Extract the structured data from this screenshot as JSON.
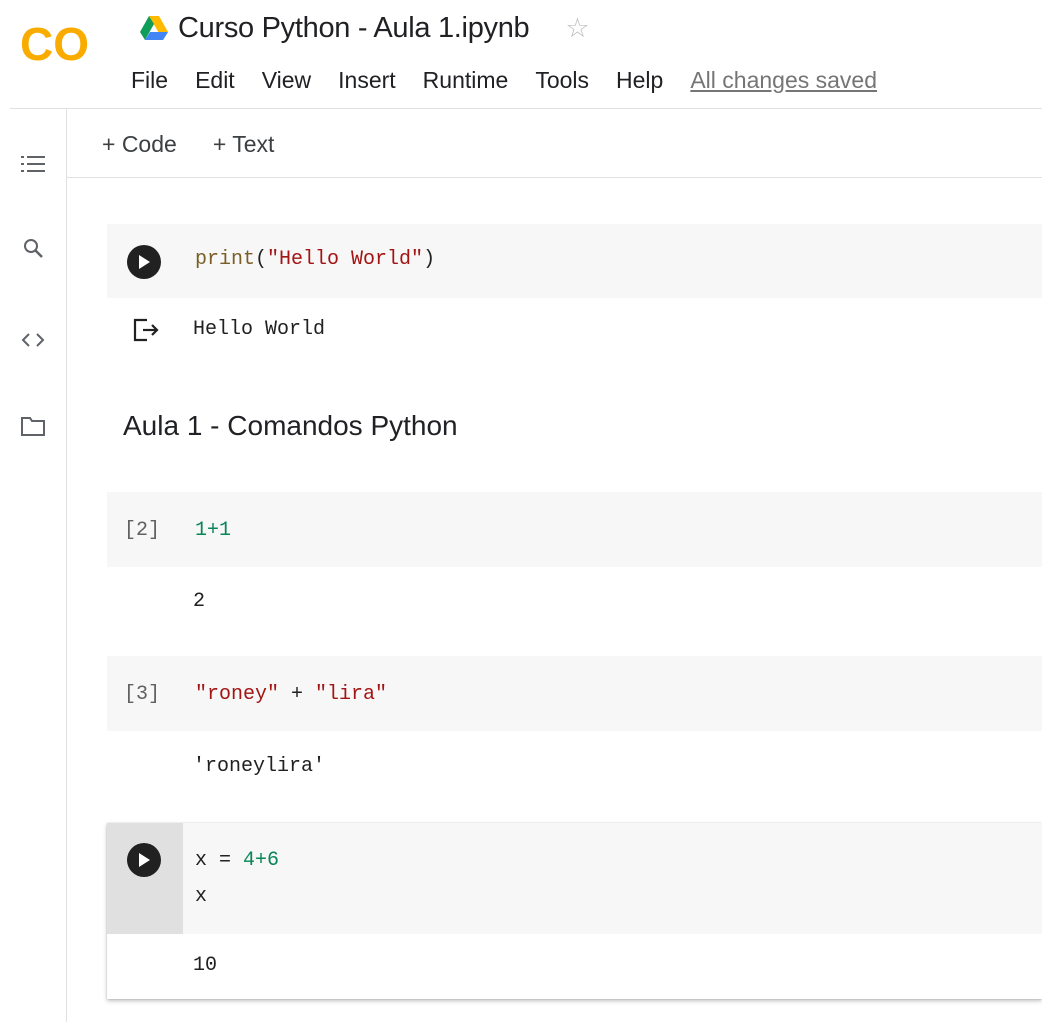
{
  "app": {
    "logo_text": "CO",
    "doc_title": "Curso Python - Aula 1.ipynb",
    "icons": {
      "drive": "drive-icon",
      "star": "star-icon"
    }
  },
  "menu": {
    "items": [
      "File",
      "Edit",
      "View",
      "Insert",
      "Runtime",
      "Tools",
      "Help"
    ],
    "status": "All changes saved"
  },
  "sidebar": {
    "icons": [
      "table-of-contents-icon",
      "search-icon",
      "code-snippets-icon",
      "files-icon"
    ]
  },
  "toolbar": {
    "add_code": "+ Code",
    "add_text": "+ Text"
  },
  "cells": [
    {
      "type": "code",
      "exec": "",
      "code_fn": "print",
      "code_open": "(",
      "code_str": "\"Hello World\"",
      "code_close": ")",
      "output": "Hello World"
    },
    {
      "type": "markdown",
      "text": "Aula 1 - Comandos Python"
    },
    {
      "type": "code",
      "exec": "[2]",
      "code": "1+1",
      "output": "2"
    },
    {
      "type": "code",
      "exec": "[3]",
      "code_s1": "\"roney\"",
      "code_op": " + ",
      "code_s2": "\"lira\"",
      "output": "'roneylira'"
    },
    {
      "type": "code",
      "exec": "",
      "code_line1_var": "x",
      "code_line1_eq": " = ",
      "code_line1_val": "4+6",
      "code_line2": "x",
      "output": "10"
    }
  ],
  "colors": {
    "string": "#a31515",
    "number": "#098658",
    "logo_orange": "#f9ab00",
    "logo_dark_orange": "#e8710a"
  }
}
